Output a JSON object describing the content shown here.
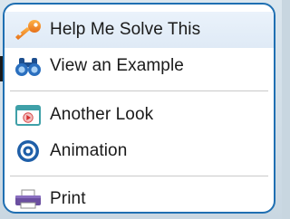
{
  "menu": {
    "items": [
      {
        "label": "Help Me Solve This",
        "icon": "key-icon",
        "active": true
      },
      {
        "label": "View an Example",
        "icon": "binoculars-icon"
      },
      {
        "label": "Another Look",
        "icon": "video-window-icon"
      },
      {
        "label": "Animation",
        "icon": "animation-icon"
      },
      {
        "label": "Print",
        "icon": "printer-icon"
      }
    ]
  },
  "colors": {
    "border": "#1f6fb2",
    "highlight": "#dfeaf6",
    "key": "#f08a1e",
    "binoculars": "#2a6fbf",
    "animation": "#1f5fa8",
    "printer": "#6b4fa0"
  }
}
